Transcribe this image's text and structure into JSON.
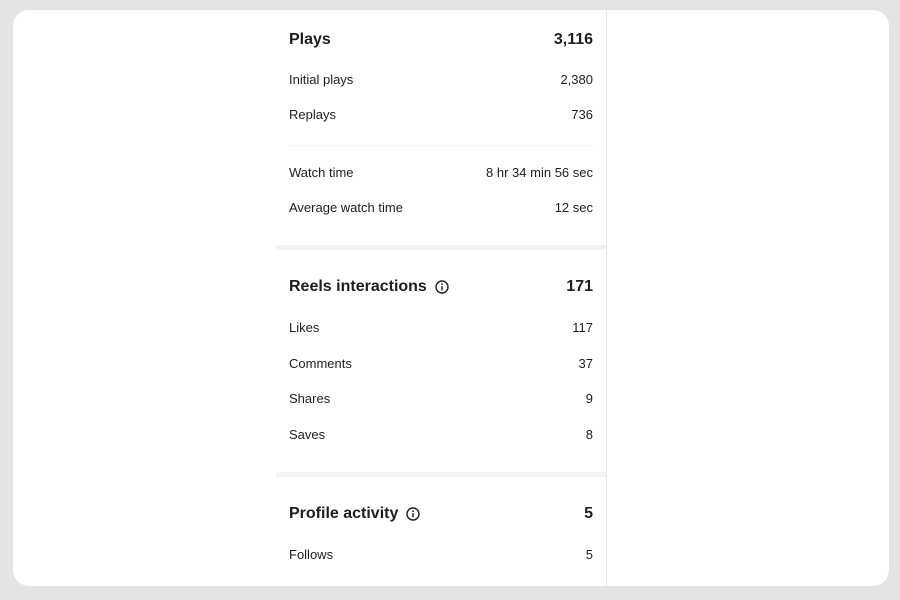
{
  "plays": {
    "title": "Plays",
    "total": "3,116",
    "rows": [
      {
        "label": "Initial plays",
        "value": "2,380"
      },
      {
        "label": "Replays",
        "value": "736"
      }
    ]
  },
  "watch": {
    "rows": [
      {
        "label": "Watch time",
        "value": "8 hr 34 min 56 sec"
      },
      {
        "label": "Average watch time",
        "value": "12 sec"
      }
    ]
  },
  "interactions": {
    "title": "Reels interactions",
    "total": "171",
    "info_icon": "info-icon",
    "rows": [
      {
        "label": "Likes",
        "value": "117"
      },
      {
        "label": "Comments",
        "value": "37"
      },
      {
        "label": "Shares",
        "value": "9"
      },
      {
        "label": "Saves",
        "value": "8"
      }
    ]
  },
  "profile": {
    "title": "Profile activity",
    "total": "5",
    "info_icon": "info-icon",
    "rows": [
      {
        "label": "Follows",
        "value": "5"
      }
    ]
  }
}
